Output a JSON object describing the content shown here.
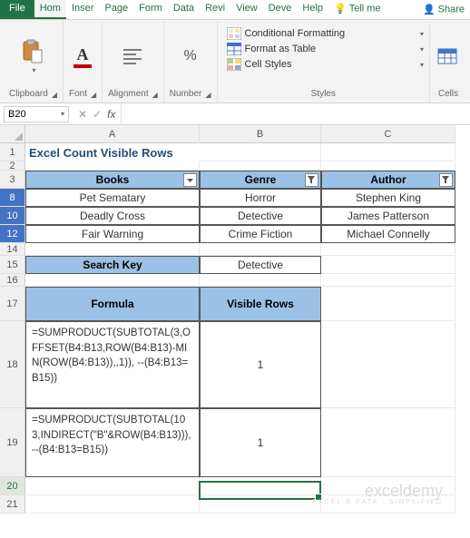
{
  "tabs": {
    "file": "File",
    "home": "Hom",
    "insert": "Inser",
    "page": "Page",
    "formulas": "Form",
    "data": "Data",
    "review": "Revi",
    "view": "View",
    "developer": "Deve",
    "help": "Help",
    "tellme": "Tell me",
    "share": "Share"
  },
  "ribbon": {
    "clipboard": "Clipboard",
    "font": "Font",
    "alignment": "Alignment",
    "number": "Number",
    "styles": "Styles",
    "cells": "Cells",
    "conditional": "Conditional Formatting",
    "format_table": "Format as Table",
    "cell_styles": "Cell Styles"
  },
  "namebox": "B20",
  "columns": {
    "A": "A",
    "B": "B",
    "C": "C"
  },
  "rows": {
    "r1": "1",
    "r2": "2",
    "r3": "3",
    "r8": "8",
    "r10": "10",
    "r12": "12",
    "r14": "14",
    "r15": "15",
    "r16": "16",
    "r17": "17",
    "r18": "18",
    "r19": "19",
    "r20": "20",
    "r21": "21"
  },
  "sheet": {
    "title": "Excel Count Visible Rows",
    "headers": {
      "books": "Books",
      "genre": "Genre",
      "author": "Author"
    },
    "data": [
      {
        "book": "Pet Sematary",
        "genre": "Horror",
        "author": "Stephen King"
      },
      {
        "book": "Deadly Cross",
        "genre": "Detective",
        "author": "James Patterson"
      },
      {
        "book": "Fair Warning",
        "genre": "Crime Fiction",
        "author": "Michael Connelly"
      }
    ],
    "search_key_label": "Search Key",
    "search_key_value": "Detective",
    "formula_label": "Formula",
    "visible_rows_label": "Visible Rows",
    "formula1": "=SUMPRODUCT(SUBTOTAL(3,OFFSET(B4:B13,ROW(B4:B13)-MIN(ROW(B4:B13)),,1)), --(B4:B13=B15))",
    "result1": "1",
    "formula2": "=SUMPRODUCT(SUBTOTAL(103,INDIRECT(\"B\"&ROW(B4:B13))),--(B4:B13=B15))",
    "result2": "1"
  },
  "watermark": {
    "main": "exceldemy",
    "sub": "EXCEL & DATA · SIMPLIFIED"
  }
}
